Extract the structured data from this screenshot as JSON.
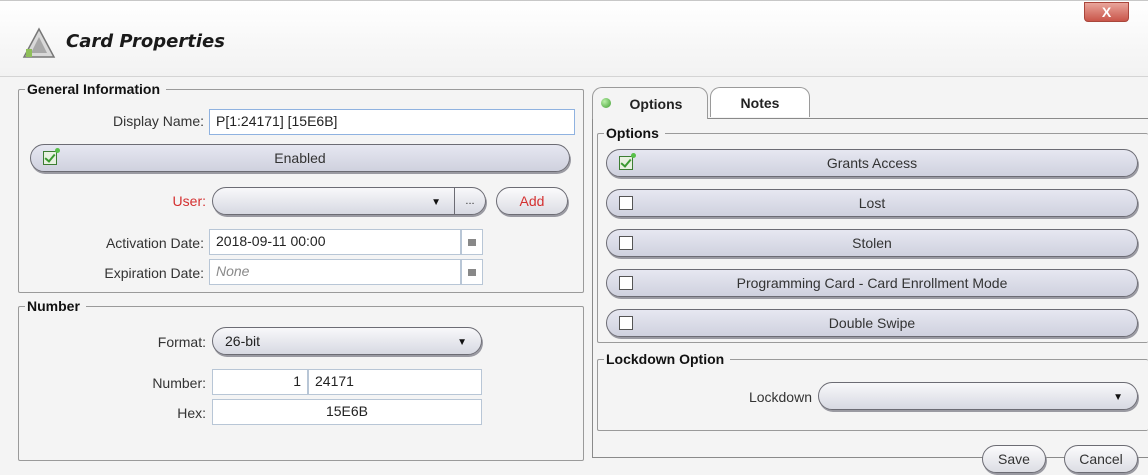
{
  "window": {
    "title": "Card Properties",
    "close_label": "X"
  },
  "general": {
    "legend": "General Information",
    "display_name_label": "Display Name:",
    "display_name_value": "P[1:24171] [15E6B]",
    "enabled_label": "Enabled",
    "enabled_checked": true,
    "user_label": "User:",
    "user_value": "",
    "browse_label": "...",
    "add_label": "Add",
    "activation_label": "Activation Date:",
    "activation_value": "2018-09-11 00:00",
    "expiration_label": "Expiration Date:",
    "expiration_placeholder": "None"
  },
  "number": {
    "legend": "Number",
    "format_label": "Format:",
    "format_value": "26-bit",
    "number_label": "Number:",
    "facility_value": "1",
    "card_value": "24171",
    "hex_label": "Hex:",
    "hex_value": "15E6B"
  },
  "tabs": [
    {
      "label": "Options",
      "active": true
    },
    {
      "label": "Notes",
      "active": false
    }
  ],
  "options": {
    "legend": "Options",
    "items": [
      {
        "label": "Grants Access",
        "checked": true
      },
      {
        "label": "Lost",
        "checked": false
      },
      {
        "label": "Stolen",
        "checked": false
      },
      {
        "label": "Programming Card - Card Enrollment Mode",
        "checked": false
      },
      {
        "label": "Double Swipe",
        "checked": false
      }
    ]
  },
  "lockdown": {
    "legend": "Lockdown Option",
    "label": "Lockdown",
    "value": ""
  },
  "footer": {
    "save_label": "Save",
    "cancel_label": "Cancel"
  },
  "colors": {
    "required_label": "#d43030",
    "check_green": "#3a9a30",
    "close_button": "#c9564a"
  }
}
